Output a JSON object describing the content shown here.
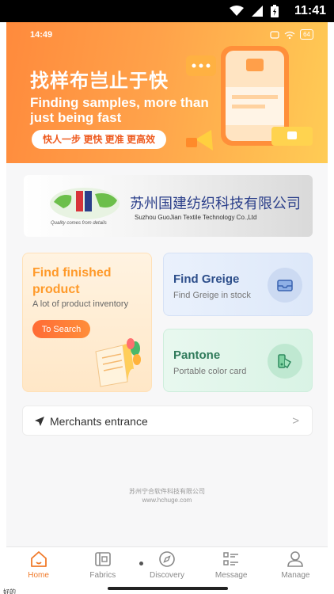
{
  "system_bar": {
    "time": "11:41"
  },
  "app_status": {
    "time": "14:49",
    "battery": "64"
  },
  "banner": {
    "title": "找样布岂止于快",
    "subtitle": "Finding samples, more than just being fast",
    "pill": "快人一步 更快 更准 更高效"
  },
  "company": {
    "name_cn": "苏州国建纺织科技有限公司",
    "name_en": "Suzhou GuoJian Textile Technology Co.,Ltd",
    "slogan": "Quality comes from details"
  },
  "cards": {
    "finished": {
      "title": "Find finished product",
      "desc": "A lot of product inventory",
      "button": "To Search"
    },
    "greige": {
      "title": "Find Greige",
      "desc": "Find Greige in stock"
    },
    "pantone": {
      "title": "Pantone",
      "desc": "Portable color card"
    }
  },
  "merchants": {
    "label": "Merchants entrance",
    "chevron": ">"
  },
  "footer": {
    "company": "苏州宁合软件科技有限公司",
    "url": "www.hchuge.com"
  },
  "nav": {
    "items": [
      {
        "label": "Home",
        "icon": "home-icon",
        "active": true
      },
      {
        "label": "Fabrics",
        "icon": "fabrics-icon",
        "active": false
      },
      {
        "label": "Discovery",
        "icon": "compass-icon",
        "active": false
      },
      {
        "label": "Message",
        "icon": "message-list-icon",
        "active": false
      },
      {
        "label": "Manage",
        "icon": "user-icon",
        "active": false
      }
    ]
  },
  "corner_text": "好的",
  "colors": {
    "accent": "#f07a2a",
    "banner": "#ffa24a",
    "greige": "#2d4e8a",
    "pantone": "#2f7a5a"
  }
}
